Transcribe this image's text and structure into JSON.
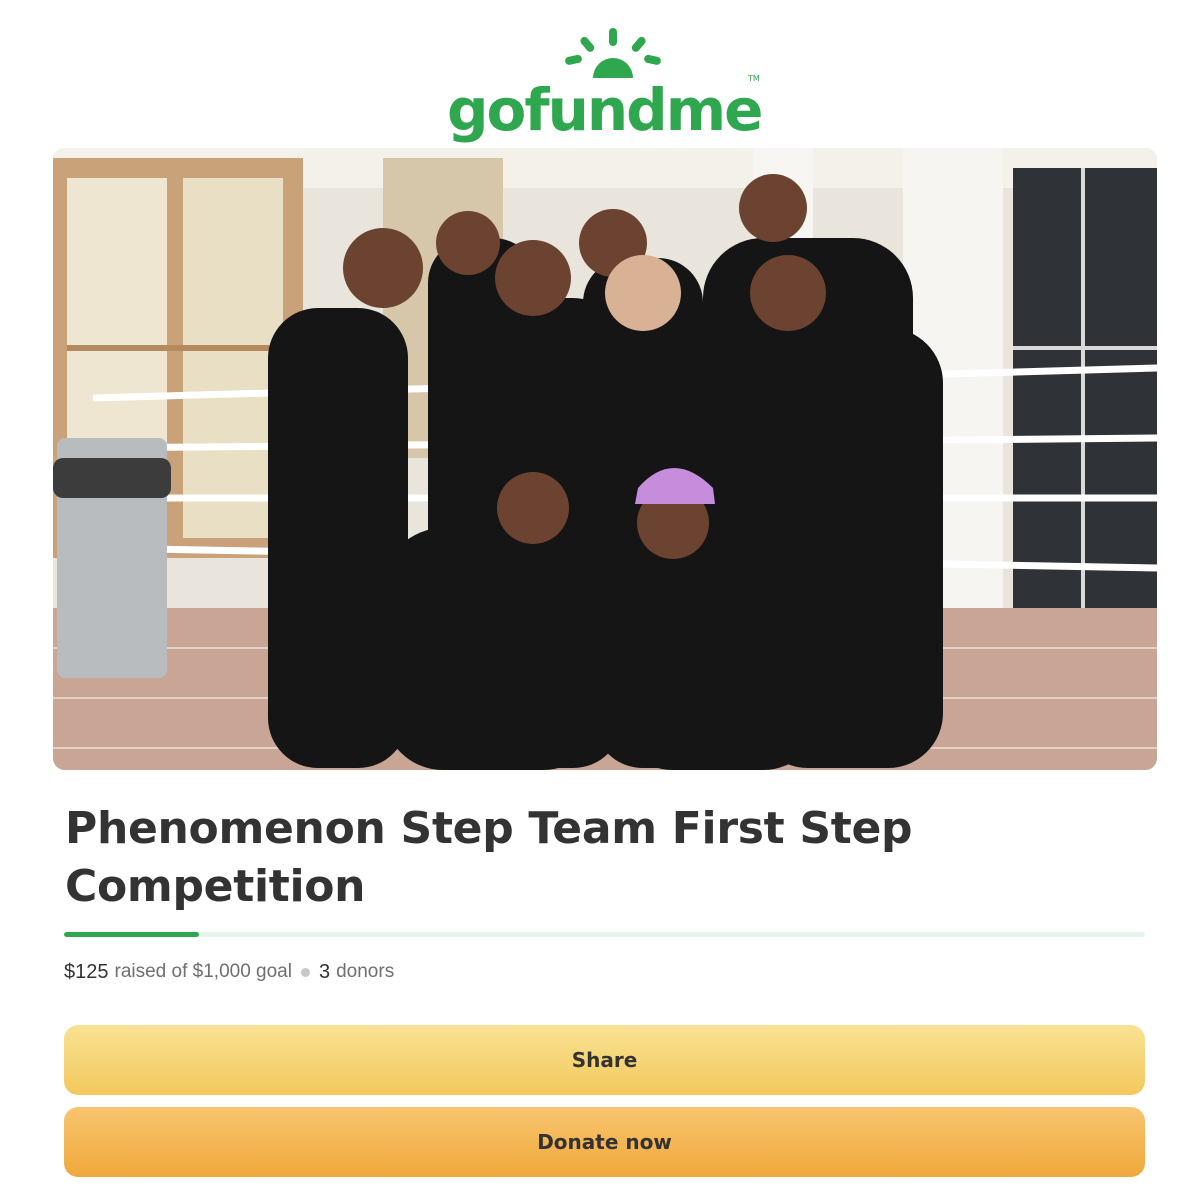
{
  "brand": {
    "logo_text": "gofundme",
    "trademark": "TM",
    "accent_color": "#2fa74f"
  },
  "campaign": {
    "photo": {
      "icon": "team-photo",
      "description_shown": false
    },
    "title": "Phenomenon Step Team First Step Competition",
    "progress_fraction": 0.125,
    "raised_amount": "$125",
    "raised_text": "raised of $1,000 goal",
    "donor_count": "3",
    "donors_text": "donors"
  },
  "actions": {
    "share_label": "Share",
    "donate_label": "Donate now",
    "share_color": "#f5d16e",
    "donate_color": "#f3b14e"
  }
}
